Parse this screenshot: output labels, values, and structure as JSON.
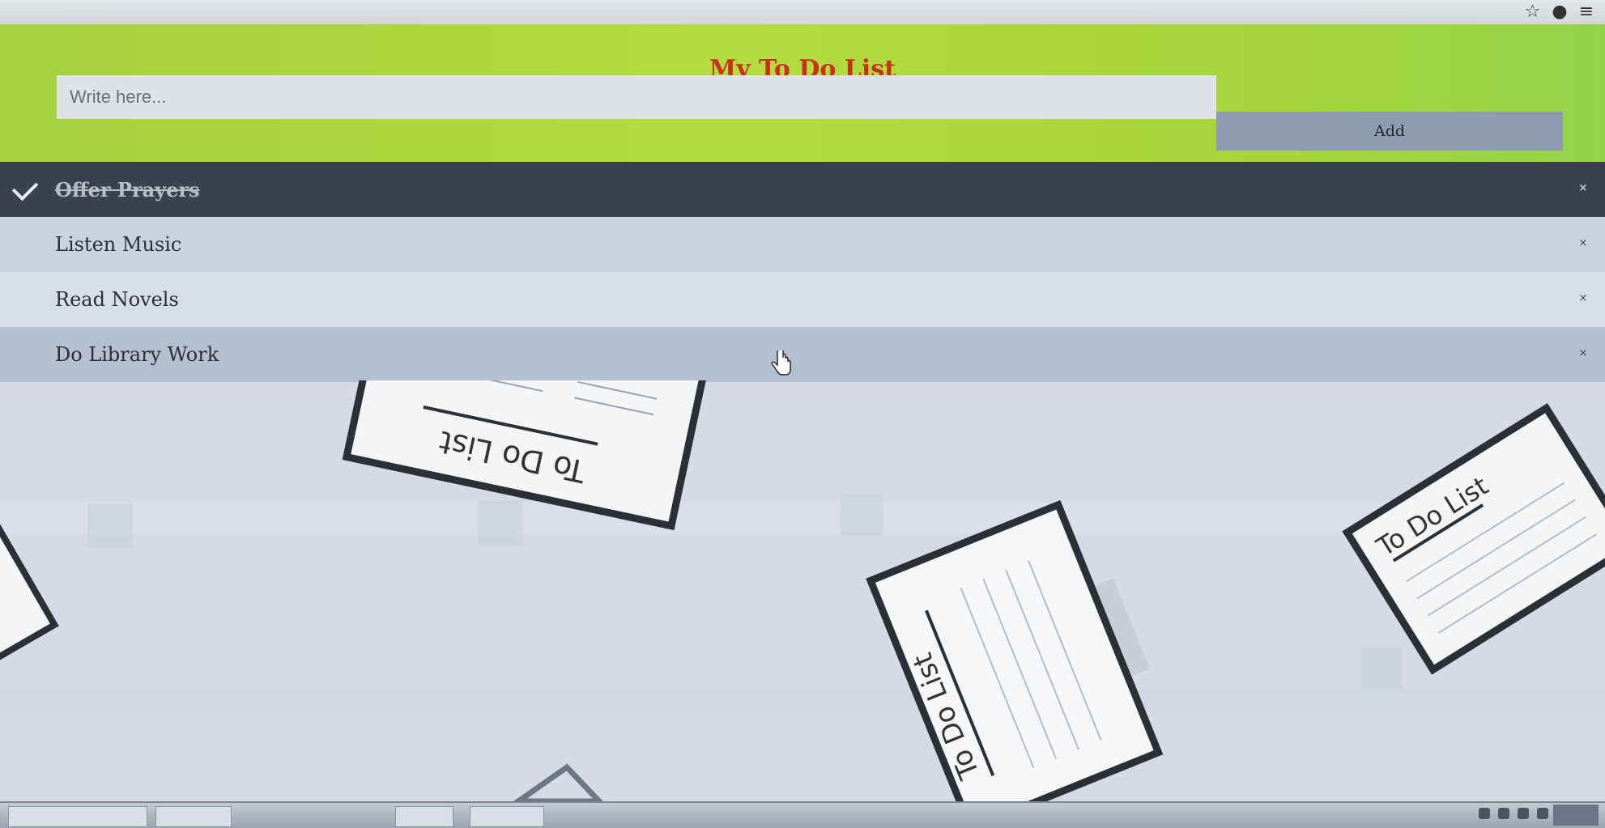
{
  "browser": {
    "icons": [
      "star-icon",
      "extension-icon",
      "menu-icon"
    ]
  },
  "app": {
    "title": "My To Do List",
    "input_placeholder": "Write here...",
    "add_label": "Add",
    "close_symbol": "×"
  },
  "todos": [
    {
      "text": "Offer Prayers",
      "checked": true
    },
    {
      "text": "Listen Music",
      "checked": false
    },
    {
      "text": "Read Novels",
      "checked": false
    },
    {
      "text": "Do Library Work",
      "checked": false
    }
  ],
  "illustration_labels": [
    "To Do List",
    "To Do List",
    "To Do List"
  ],
  "colors": {
    "header_bg": "#aed63e",
    "title": "#c8311f",
    "add_button": "#8e9bb2",
    "checked_row": "#3a4250"
  }
}
